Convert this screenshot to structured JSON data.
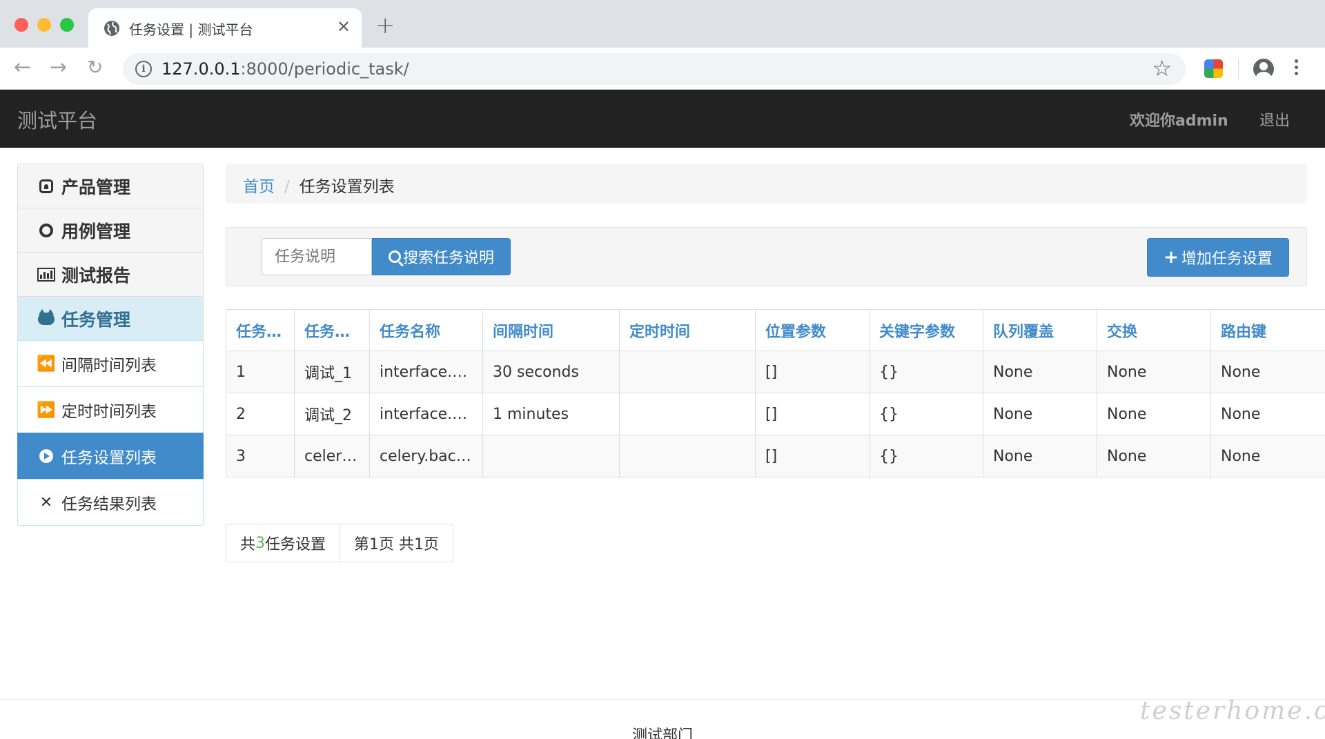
{
  "browser": {
    "tab_title": "任务设置 | 测试平台",
    "url_host": "127.0.0.1",
    "url_rest": ":8000/periodic_task/"
  },
  "navbar": {
    "brand": "测试平台",
    "welcome": "欢迎你admin",
    "logout": "退出"
  },
  "sidebar": {
    "items": [
      {
        "label": "产品管理",
        "icon": "github-square-icon"
      },
      {
        "label": "用例管理",
        "icon": "github-icon"
      },
      {
        "label": "测试报告",
        "icon": "bar-chart-icon"
      },
      {
        "label": "任务管理",
        "icon": "github-alt-icon"
      },
      {
        "label": "间隔时间列表",
        "icon": "backward-icon"
      },
      {
        "label": "定时时间列表",
        "icon": "forward-icon"
      },
      {
        "label": "任务设置列表",
        "icon": "play-circle-icon"
      },
      {
        "label": "任务结果列表",
        "icon": "expand-icon"
      }
    ]
  },
  "breadcrumb": {
    "home": "首页",
    "separator": "/",
    "current": "任务设置列表"
  },
  "search": {
    "placeholder": "任务说明",
    "button_label": "搜索任务说明",
    "add_label": "增加任务设置"
  },
  "table": {
    "headers": [
      "任务ID",
      "任务说明",
      "任务名称",
      "间隔时间",
      "定时时间",
      "位置参数",
      "关键字参数",
      "队列覆盖",
      "交换",
      "路由键"
    ],
    "rows": [
      [
        "1",
        "调试_1",
        "interface.t…",
        "30 seconds",
        "",
        "[]",
        "{}",
        "None",
        "None",
        "None"
      ],
      [
        "2",
        "调试_2",
        "interface.t…",
        "1 minutes",
        "",
        "[]",
        "{}",
        "None",
        "None",
        "None"
      ],
      [
        "3",
        "celery.b…",
        "celery.bac…",
        "",
        "",
        "[]",
        "{}",
        "None",
        "None",
        "None"
      ]
    ]
  },
  "pager": {
    "prefix": "共",
    "count": "3",
    "suffix": "任务设置",
    "page_info": "第1页 共1页"
  },
  "footer": {
    "text": "测试部门",
    "watermark": "testerhome.com"
  },
  "colors": {
    "navbar": "#222222",
    "primary": "#428bca",
    "highlight": "#d9edf7",
    "count_green": "#5cb85c"
  }
}
